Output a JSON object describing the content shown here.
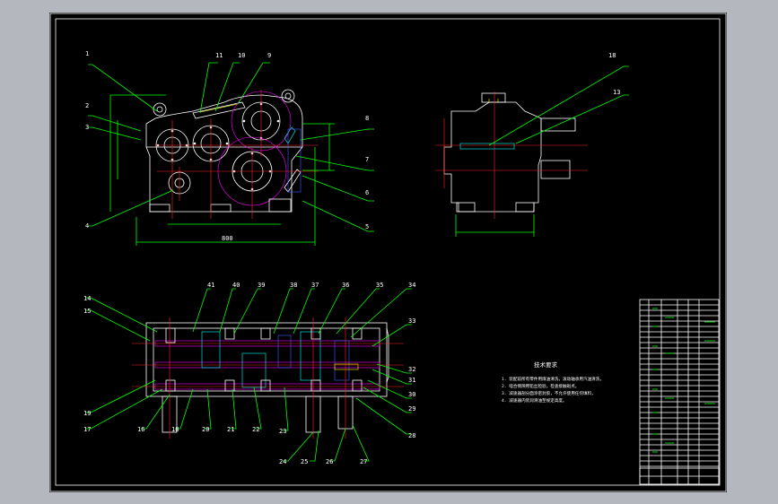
{
  "colors": {
    "background": "#b4b8be",
    "canvas": "#000000",
    "border": "#ffffff",
    "leader": "#00ff00",
    "centerline": "#ff2020",
    "hatch": "#ff00ff",
    "section": "#00ffff",
    "highlight": "#ffff00"
  },
  "front_view": {
    "labels": [
      "1",
      "2",
      "3",
      "4",
      "11",
      "10",
      "9",
      "8",
      "7",
      "6",
      "5"
    ]
  },
  "side_view": {
    "labels": [
      "18",
      "13"
    ]
  },
  "section_view": {
    "labels_top": [
      "14",
      "15",
      "41",
      "40",
      "39",
      "38",
      "37",
      "36",
      "35",
      "34",
      "33"
    ],
    "labels_right": [
      "32",
      "31",
      "30",
      "29",
      "28"
    ],
    "labels_bottom": [
      "19",
      "17",
      "16",
      "18",
      "20",
      "21",
      "22",
      "23",
      "24",
      "25",
      "26",
      "27"
    ]
  },
  "notes": {
    "title": "技术要求",
    "lines": [
      "1. 装配前所有零件用煤油清洗，滚动轴承用汽油清洗，",
      "2. 啮合侧隙用铅丝检验，检查接触斑点，",
      "3. 减速器剖分面涂密封胶，不允许使用任何填料，",
      "4. 减速器内装润滑油至规定高度。"
    ]
  }
}
